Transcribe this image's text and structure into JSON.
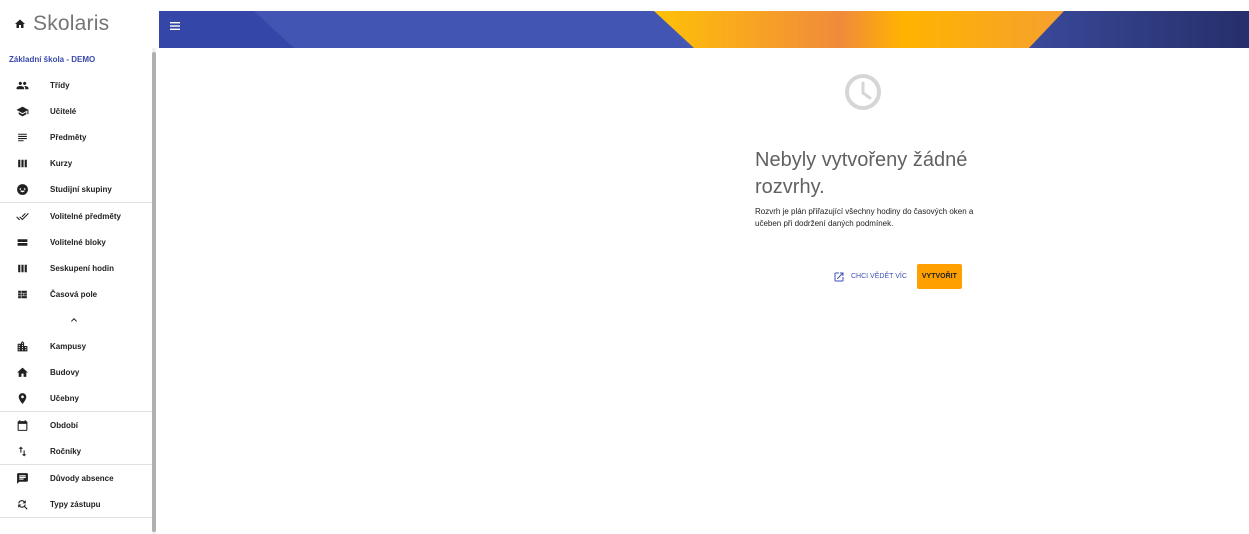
{
  "app": {
    "name": "Skolaris",
    "school": "Základní škola - DEMO"
  },
  "sidebar": {
    "groups": [
      [
        {
          "label": "Třídy",
          "icon": "people-icon"
        },
        {
          "label": "Učitelé",
          "icon": "graduation-cap-icon"
        },
        {
          "label": "Předměty",
          "icon": "subject-lines-icon"
        },
        {
          "label": "Kurzy",
          "icon": "columns-icon"
        },
        {
          "label": "Studijní skupiny",
          "icon": "group-circle-icon"
        }
      ],
      [
        {
          "label": "Volitelné předměty",
          "icon": "double-check-icon"
        },
        {
          "label": "Volitelné bloky",
          "icon": "blocks-icon"
        },
        {
          "label": "Seskupení hodin",
          "icon": "columns-icon"
        },
        {
          "label": "Časová pole",
          "icon": "grid-blocks-icon"
        }
      ],
      [
        {
          "label": "Kampusy",
          "icon": "city-icon"
        },
        {
          "label": "Budovy",
          "icon": "home-icon"
        },
        {
          "label": "Učebny",
          "icon": "location-pin-icon"
        }
      ],
      [
        {
          "label": "Období",
          "icon": "calendar-icon"
        },
        {
          "label": "Ročníky",
          "icon": "sort-arrows-icon"
        }
      ],
      [
        {
          "label": "Důvody absence",
          "icon": "chat-icon"
        },
        {
          "label": "Typy zástupu",
          "icon": "swap-search-icon"
        }
      ]
    ]
  },
  "empty_state": {
    "title": "Nebyly vytvořeny žádné rozvrhy.",
    "description": "Rozvrh je plán přiřazující všechny hodiny do časových oken a učeben při dodržení daných podmínek.",
    "learn_more": "Chci vědět víc",
    "create": "Vytvořit"
  },
  "colors": {
    "primary": "#3f51b5",
    "accent": "#ffa000",
    "school_link": "#3949ab"
  }
}
